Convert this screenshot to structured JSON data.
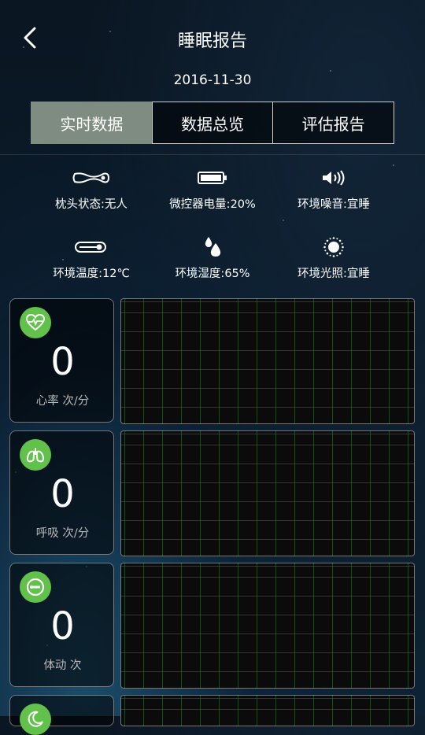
{
  "header": {
    "title": "睡眠报告",
    "date": "2016-11-30"
  },
  "tabs": [
    {
      "label": "实时数据",
      "active": true
    },
    {
      "label": "数据总览",
      "active": false
    },
    {
      "label": "评估报告",
      "active": false
    }
  ],
  "status": [
    {
      "icon": "pillow-icon",
      "label": "枕头状态:无人"
    },
    {
      "icon": "battery-icon",
      "label": "微控器电量:20%"
    },
    {
      "icon": "speaker-icon",
      "label": "环境噪音:宜睡"
    },
    {
      "icon": "thermometer-icon",
      "label": "环境温度:12℃"
    },
    {
      "icon": "water-drops-icon",
      "label": "环境湿度:65%"
    },
    {
      "icon": "sun-icon",
      "label": "环境光照:宜睡"
    }
  ],
  "metrics": [
    {
      "icon": "heart-rate-icon",
      "value": "0",
      "unit": "心率 次/分"
    },
    {
      "icon": "lungs-icon",
      "value": "0",
      "unit": "呼吸 次/分"
    },
    {
      "icon": "movement-icon",
      "value": "0",
      "unit": "体动 次"
    }
  ],
  "colors": {
    "accent_green": "#62c14a",
    "tab_active": "#7f8c82",
    "grid_line": "#287846"
  }
}
